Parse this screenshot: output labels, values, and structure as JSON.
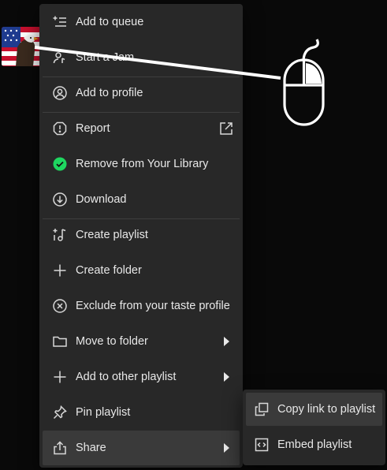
{
  "menu": {
    "items": [
      {
        "label": "Add to queue",
        "icon": "add-to-queue-icon"
      },
      {
        "label": "Start a Jam",
        "icon": "jam-icon"
      },
      {
        "label": "Add to profile",
        "icon": "profile-icon"
      },
      {
        "label": "Report",
        "icon": "report-icon",
        "external": true
      },
      {
        "label": "Remove from Your Library",
        "icon": "check-circle-icon",
        "accent": "#1ed760"
      },
      {
        "label": "Download",
        "icon": "download-icon"
      },
      {
        "label": "Create playlist",
        "icon": "create-playlist-icon"
      },
      {
        "label": "Create folder",
        "icon": "plus-icon"
      },
      {
        "label": "Exclude from your taste profile",
        "icon": "exclude-icon"
      },
      {
        "label": "Move to folder",
        "icon": "folder-icon",
        "submenu": true
      },
      {
        "label": "Add to other playlist",
        "icon": "plus-icon",
        "submenu": true
      },
      {
        "label": "Pin playlist",
        "icon": "pin-icon"
      },
      {
        "label": "Share",
        "icon": "share-icon",
        "submenu": true,
        "hovered": true
      }
    ]
  },
  "share_submenu": {
    "items": [
      {
        "label": "Copy link to playlist",
        "icon": "copy-link-icon",
        "hovered": true
      },
      {
        "label": "Embed playlist",
        "icon": "embed-icon"
      }
    ]
  },
  "colors": {
    "menu_bg": "#282828",
    "hover_bg": "#3a3a3a",
    "accent_green": "#1ed760",
    "text": "#e8e8e8"
  }
}
